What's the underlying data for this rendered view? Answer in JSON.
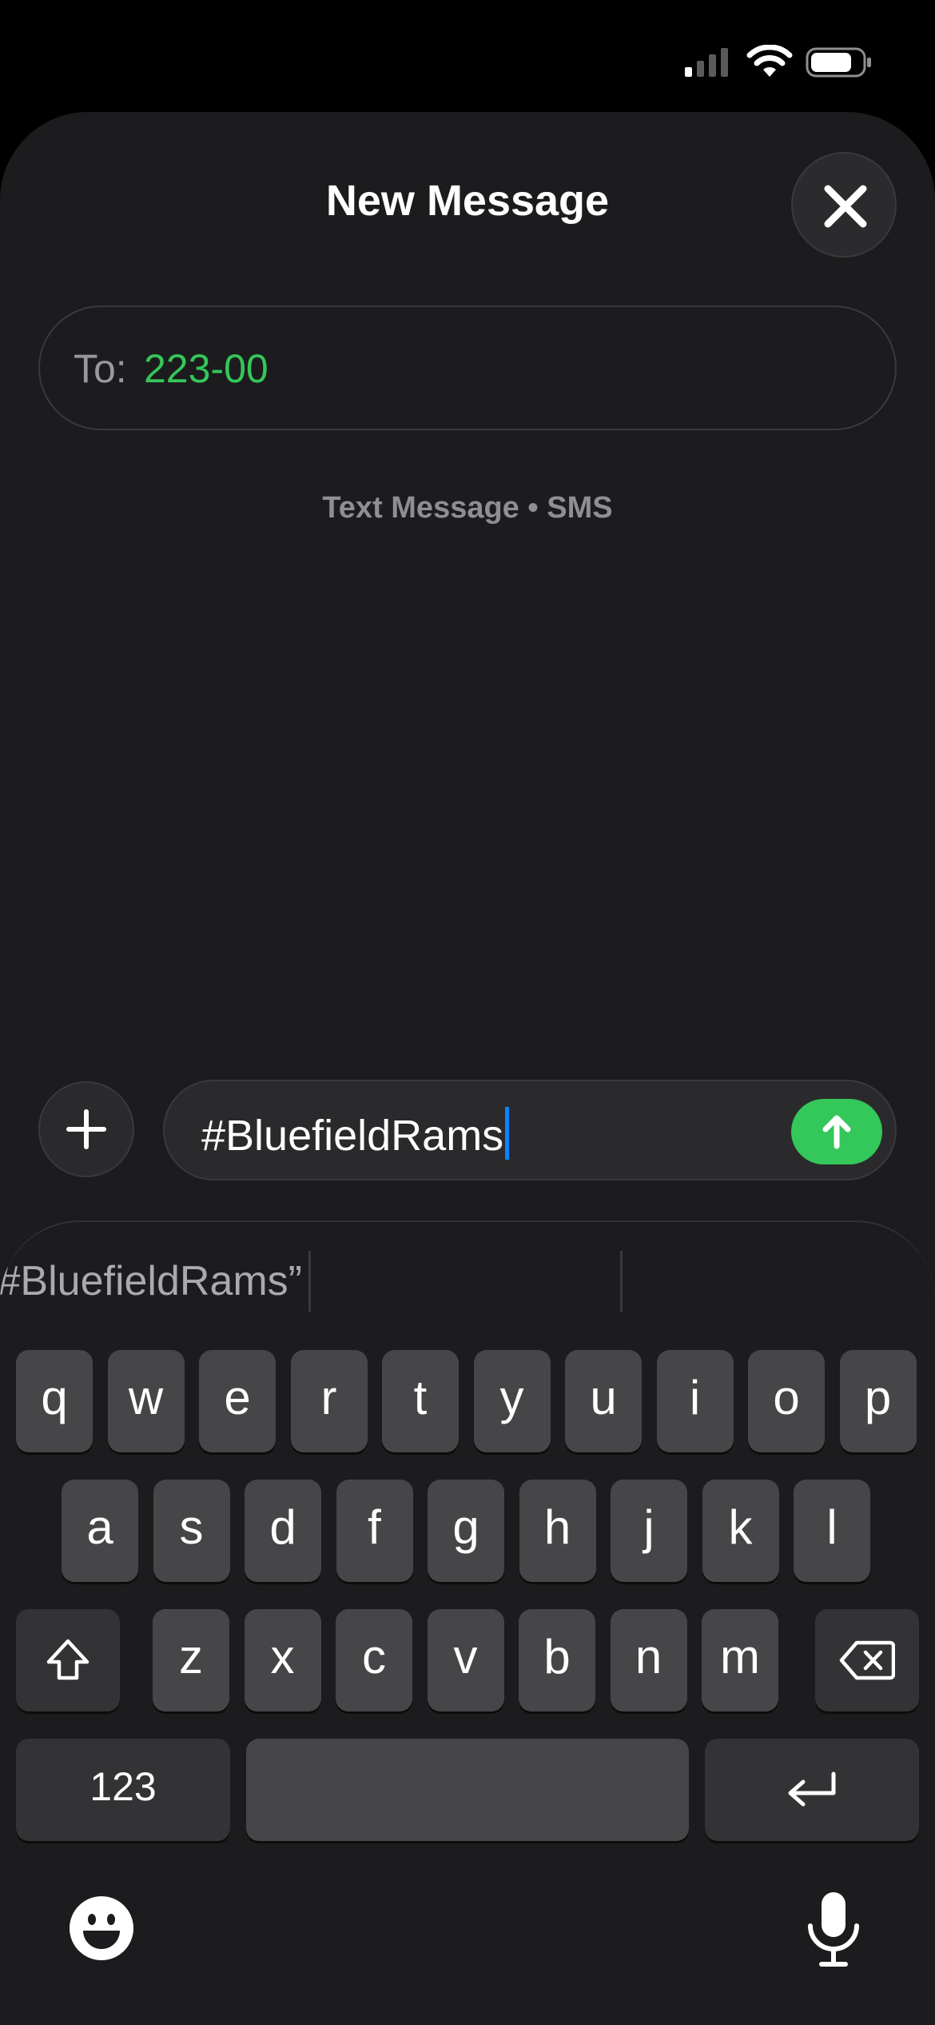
{
  "status_bar": {
    "signal_icon": "cellular-signal-icon",
    "wifi_icon": "wifi-icon",
    "battery_icon": "battery-icon",
    "battery_level": 0.8
  },
  "sheet": {
    "title": "New Message",
    "close_icon": "close-icon"
  },
  "recipient": {
    "label": "To:",
    "value": "223-00"
  },
  "service_label": "Text Message • SMS",
  "compose": {
    "attach_icon": "plus-icon",
    "text": "#BluefieldRams",
    "send_icon": "arrow-up-icon"
  },
  "keyboard": {
    "suggestion": "“#BluefieldRams”",
    "row1": [
      "q",
      "w",
      "e",
      "r",
      "t",
      "y",
      "u",
      "i",
      "o",
      "p"
    ],
    "row2": [
      "a",
      "s",
      "d",
      "f",
      "g",
      "h",
      "j",
      "k",
      "l"
    ],
    "row3": [
      "z",
      "x",
      "c",
      "v",
      "b",
      "n",
      "m"
    ],
    "numbers_label": "123",
    "shift_icon": "shift-icon",
    "delete_icon": "delete-icon",
    "return_icon": "return-icon",
    "emoji_icon": "emoji-icon",
    "mic_icon": "microphone-icon"
  },
  "colors": {
    "accent_green": "#34c759",
    "caret_blue": "#0a84ff",
    "sheet_bg": "#1c1c1e",
    "key_bg": "#464649"
  }
}
